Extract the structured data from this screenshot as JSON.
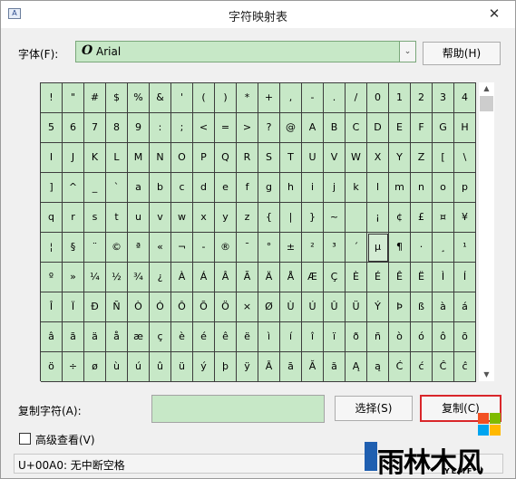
{
  "window": {
    "title": "字符映射表",
    "app_icon": "charmap-app-icon",
    "close_glyph": "✕"
  },
  "font": {
    "label": "字体(F):",
    "value": "Arial",
    "glyph": "O",
    "arrow": "⌄"
  },
  "help_button": "帮助(H)",
  "grid": {
    "columns": 20,
    "selected": [
      15,
      5
    ],
    "rows": [
      [
        "!",
        "\"",
        "#",
        "$",
        "%",
        "&",
        "'",
        "(",
        ")",
        "*",
        "+",
        ",",
        "-",
        ".",
        "/",
        "0",
        "1",
        "2",
        "3",
        "4"
      ],
      [
        "5",
        "6",
        "7",
        "8",
        "9",
        ":",
        ";",
        "<",
        "=",
        ">",
        "?",
        "@",
        "A",
        "B",
        "C",
        "D",
        "E",
        "F",
        "G",
        "H"
      ],
      [
        "I",
        "J",
        "K",
        "L",
        "M",
        "N",
        "O",
        "P",
        "Q",
        "R",
        "S",
        "T",
        "U",
        "V",
        "W",
        "X",
        "Y",
        "Z",
        "[",
        "\\"
      ],
      [
        "]",
        "^",
        "_",
        "`",
        "a",
        "b",
        "c",
        "d",
        "e",
        "f",
        "g",
        "h",
        "i",
        "j",
        "k",
        "l",
        "m",
        "n",
        "o",
        "p"
      ],
      [
        "q",
        "r",
        "s",
        "t",
        "u",
        "v",
        "w",
        "x",
        "y",
        "z",
        "{",
        "|",
        "}",
        "~",
        " ",
        "¡",
        "¢",
        "£",
        "¤",
        "¥"
      ],
      [
        "¦",
        "§",
        "¨",
        "©",
        "ª",
        "«",
        "¬",
        "-",
        "®",
        "¯",
        "°",
        "±",
        "²",
        "³",
        "´",
        "µ",
        "¶",
        "·",
        "¸",
        "¹"
      ],
      [
        "º",
        "»",
        "¼",
        "½",
        "¾",
        "¿",
        "À",
        "Á",
        "Â",
        "Ã",
        "Ä",
        "Å",
        "Æ",
        "Ç",
        "È",
        "É",
        "Ê",
        "Ë",
        "Ì",
        "Í"
      ],
      [
        "Î",
        "Ï",
        "Ð",
        "Ñ",
        "Ò",
        "Ó",
        "Ô",
        "Õ",
        "Ö",
        "×",
        "Ø",
        "Ù",
        "Ú",
        "Û",
        "Ü",
        "Ý",
        "Þ",
        "ß",
        "à",
        "á"
      ],
      [
        "â",
        "ã",
        "ä",
        "å",
        "æ",
        "ç",
        "è",
        "é",
        "ê",
        "ë",
        "ì",
        "í",
        "î",
        "ï",
        "ð",
        "ñ",
        "ò",
        "ó",
        "ô",
        "õ"
      ],
      [
        "ö",
        "÷",
        "ø",
        "ù",
        "ú",
        "û",
        "ü",
        "ý",
        "þ",
        "ÿ",
        "Ā",
        "ā",
        "Ă",
        "ă",
        "Ą",
        "ą",
        "Ć",
        "ć",
        "Ĉ",
        "ĉ"
      ]
    ]
  },
  "scrollbar": {
    "up": "▲",
    "down": "▼"
  },
  "copy": {
    "label": "复制字符(A):",
    "value": "",
    "select_button": "选择(S)",
    "copy_button": "复制(C)"
  },
  "advanced": {
    "label": "高级查看(V)",
    "checked": false
  },
  "status": {
    "text": "U+00A0: 无中断空格"
  },
  "watermark": {
    "text": "雨林木风",
    "sub": "YLMF"
  },
  "colors": {
    "grid_bg": "#c7e8c7",
    "highlight": "#d9262a",
    "win_red": "#f25022",
    "win_green": "#7fba00",
    "win_blue": "#00a4ef",
    "win_yellow": "#ffb900"
  }
}
